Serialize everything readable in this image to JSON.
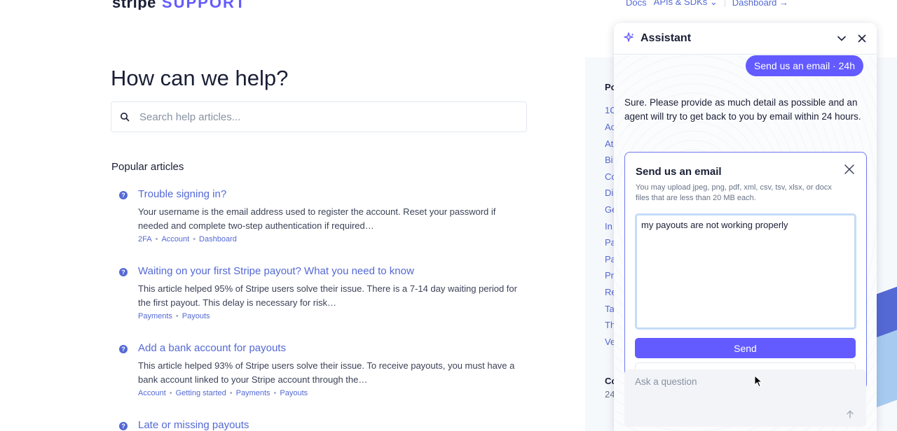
{
  "header": {
    "logo_brand": "stripe",
    "logo_product": "SUPPORT",
    "nav": [
      {
        "label": "Docs"
      },
      {
        "label": "APIs & SDKs"
      },
      {
        "label": "Dashboard →"
      }
    ]
  },
  "main": {
    "headline": "How can we help?",
    "search_placeholder": "Search help articles...",
    "popular_title": "Popular articles",
    "articles": [
      {
        "title": "Trouble signing in?",
        "desc": "Your username is the email address used to register the account. Reset your password if needed and complete two-step authentication if required…",
        "tags": [
          "2FA",
          "Account",
          "Dashboard"
        ]
      },
      {
        "title": "Waiting on your first Stripe payout? What you need to know",
        "desc": "This article helped 95% of Stripe users solve their issue. There is a 7-14 day waiting period for the first payout. This delay is necessary for risk…",
        "tags": [
          "Payments",
          "Payouts"
        ]
      },
      {
        "title": "Add a bank account for payouts",
        "desc": "This article helped 93% of Stripe users solve their issue. To receive payouts, you must have a bank account linked to your Stripe account through the…",
        "tags": [
          "Account",
          "Getting started",
          "Payments",
          "Payouts"
        ]
      },
      {
        "title": "Late or missing payouts",
        "desc": "",
        "tags": []
      }
    ]
  },
  "right_column": {
    "fragments": [
      "Po",
      "1C",
      "Ac",
      "At",
      "Bi",
      "Co",
      "Di",
      "Ge",
      "In",
      "Pa",
      "Pa",
      "Pr",
      "Re",
      "Ta",
      "Th",
      "Ve",
      "Co",
      "24"
    ]
  },
  "assistant": {
    "title": "Assistant",
    "user_pill": "Send us an email · 24h",
    "bot_message": "Sure. Please provide as much detail as possible and an agent will try to get back to you by email within 24 hours.",
    "email_card": {
      "title": "Send us an email",
      "note": "You may upload jpeg, png, pdf, xml, csv, tsv, xlsx, or docx files that are less than 20 MB each.",
      "message": "my payouts are not working properly",
      "send_label": "Send"
    },
    "ask_placeholder": "Ask a question"
  },
  "colors": {
    "accent": "#635bff",
    "link": "#5469d4"
  }
}
